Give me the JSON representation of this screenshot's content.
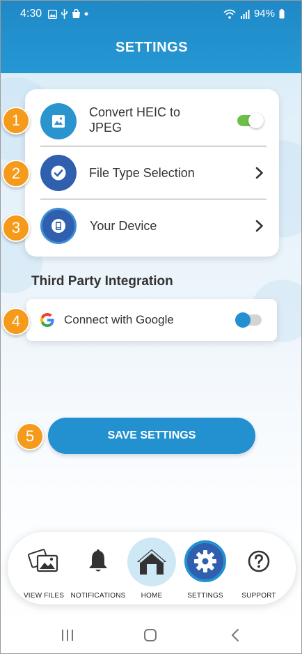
{
  "status_bar": {
    "time": "4:30",
    "battery": "94%"
  },
  "header": {
    "title": "SETTINGS"
  },
  "settings_rows": [
    {
      "badge": "1",
      "label_line1": "Convert HEIC to",
      "label_line2": "JPEG",
      "icon": "image-icon",
      "control": "toggle",
      "toggle_on": true
    },
    {
      "badge": "2",
      "label": "File Type Selection",
      "icon": "check-circle-icon",
      "control": "chevron"
    },
    {
      "badge": "3",
      "label": "Your Device",
      "icon": "device-icon",
      "control": "chevron"
    }
  ],
  "third_party": {
    "heading": "Third Party Integration",
    "badge": "4",
    "google_label": "Connect with Google",
    "toggle_on": false
  },
  "save": {
    "badge": "5",
    "label": "SAVE SETTINGS"
  },
  "bottom_nav": [
    {
      "label": "VIEW FILES",
      "icon": "photos-icon"
    },
    {
      "label": "NOTIFICATIONS",
      "icon": "bell-icon"
    },
    {
      "label": "HOME",
      "icon": "home-icon"
    },
    {
      "label": "SETTINGS",
      "icon": "gear-icon",
      "active": true
    },
    {
      "label": "SUPPORT",
      "icon": "question-icon"
    }
  ],
  "colors": {
    "header_blue": "#2598d4",
    "accent_blue": "#2390cf",
    "dark_blue": "#2f5fae",
    "badge_orange": "#f59a1b",
    "toggle_green": "#6cc04a"
  }
}
